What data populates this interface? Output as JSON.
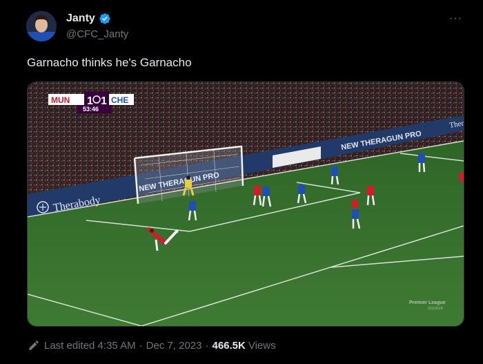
{
  "author": {
    "name": "Janty",
    "handle": "@CFC_Janty",
    "verified": true
  },
  "more_label": "···",
  "tweet_text": "Garnacho thinks he's Garnacho",
  "media": {
    "scorebug": {
      "home": "MUN",
      "home_score": "1",
      "away_score": "1",
      "away": "CHE",
      "clock": "53:46"
    },
    "ad_boards": {
      "therabody": "Therabody",
      "theragun_right": "NEW THERAGUN PRO",
      "goal_board": "NEW THERAGUN PRO",
      "top_right": "Ther"
    },
    "watermark_line1": "Premier League",
    "watermark_line2": "2023/24"
  },
  "footer": {
    "edited": "Last edited 4:35 AM",
    "date": "Dec 7, 2023",
    "views_count": "466.5K",
    "views_label": "Views",
    "separator": "·"
  },
  "colors": {
    "background": "#000000",
    "text_primary": "#e7e9ea",
    "text_secondary": "#71767b",
    "verified_blue": "#1d9bf0",
    "pitch_green": "#3b6f2e",
    "mun_red": "#d7192a",
    "che_blue": "#1f4fb5",
    "scorebug_purple": "#37003c"
  }
}
